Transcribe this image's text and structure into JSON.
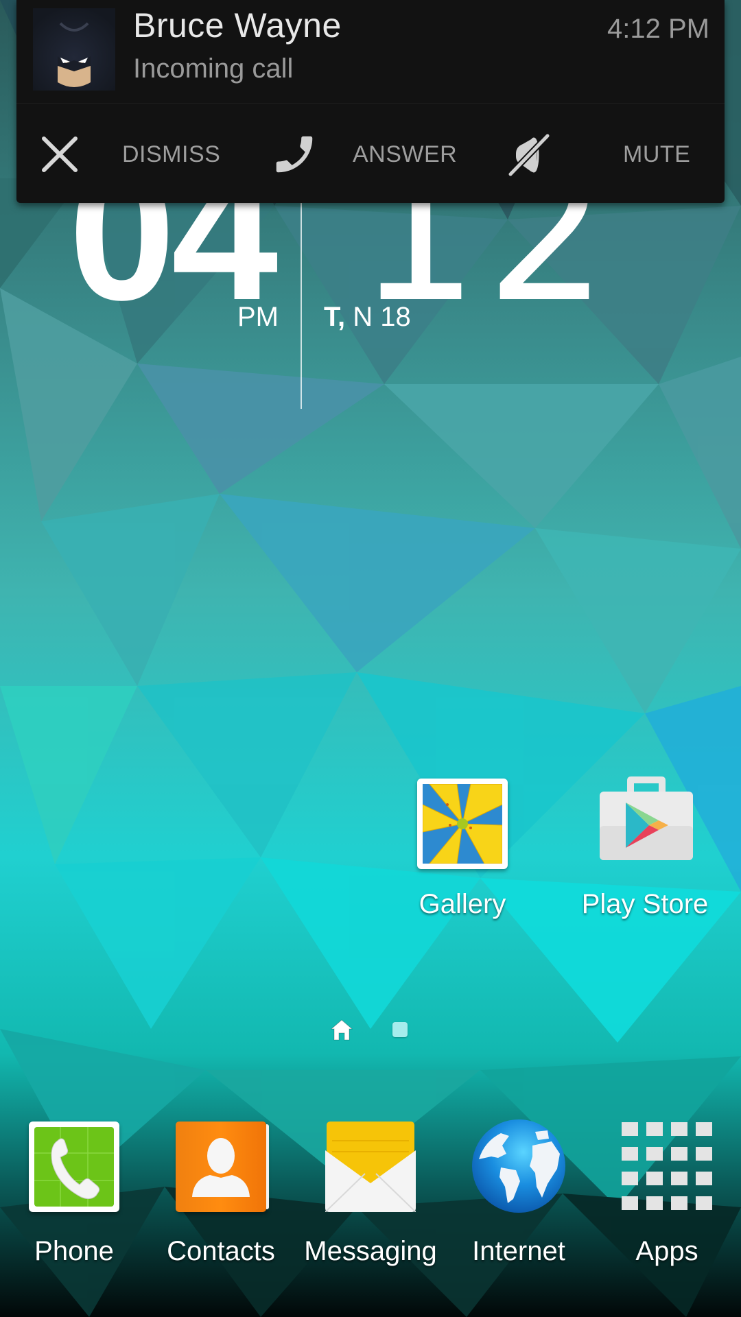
{
  "notification": {
    "caller_name": "Bruce Wayne",
    "subtitle": "Incoming call",
    "time": "4:12 PM",
    "avatar_icon": "batman-avatar-icon",
    "actions": [
      {
        "icon": "close-icon",
        "label": "DISMISS"
      },
      {
        "icon": "phone-icon",
        "label": "ANSWER"
      },
      {
        "icon": "mute-speaker-icon",
        "label": "MUTE"
      }
    ]
  },
  "clock": {
    "hour": "04",
    "minute": "12",
    "ampm": "PM",
    "date_day": "T,",
    "date_rest": "N 18"
  },
  "home_apps": [
    {
      "label": "Gallery",
      "icon": "gallery-icon"
    },
    {
      "label": "Play Store",
      "icon": "play-store-icon"
    }
  ],
  "page_indicator": {
    "pages": [
      "home",
      "page-2"
    ],
    "current": "home"
  },
  "dock": [
    {
      "label": "Phone",
      "icon": "phone-app-icon"
    },
    {
      "label": "Contacts",
      "icon": "contacts-icon"
    },
    {
      "label": "Messaging",
      "icon": "messaging-icon"
    },
    {
      "label": "Internet",
      "icon": "internet-globe-icon"
    },
    {
      "label": "Apps",
      "icon": "apps-grid-icon"
    }
  ],
  "colors": {
    "notification_bg": "#121212",
    "notification_text": "#e8e8e8",
    "notification_secondary": "#9a9a9a"
  }
}
